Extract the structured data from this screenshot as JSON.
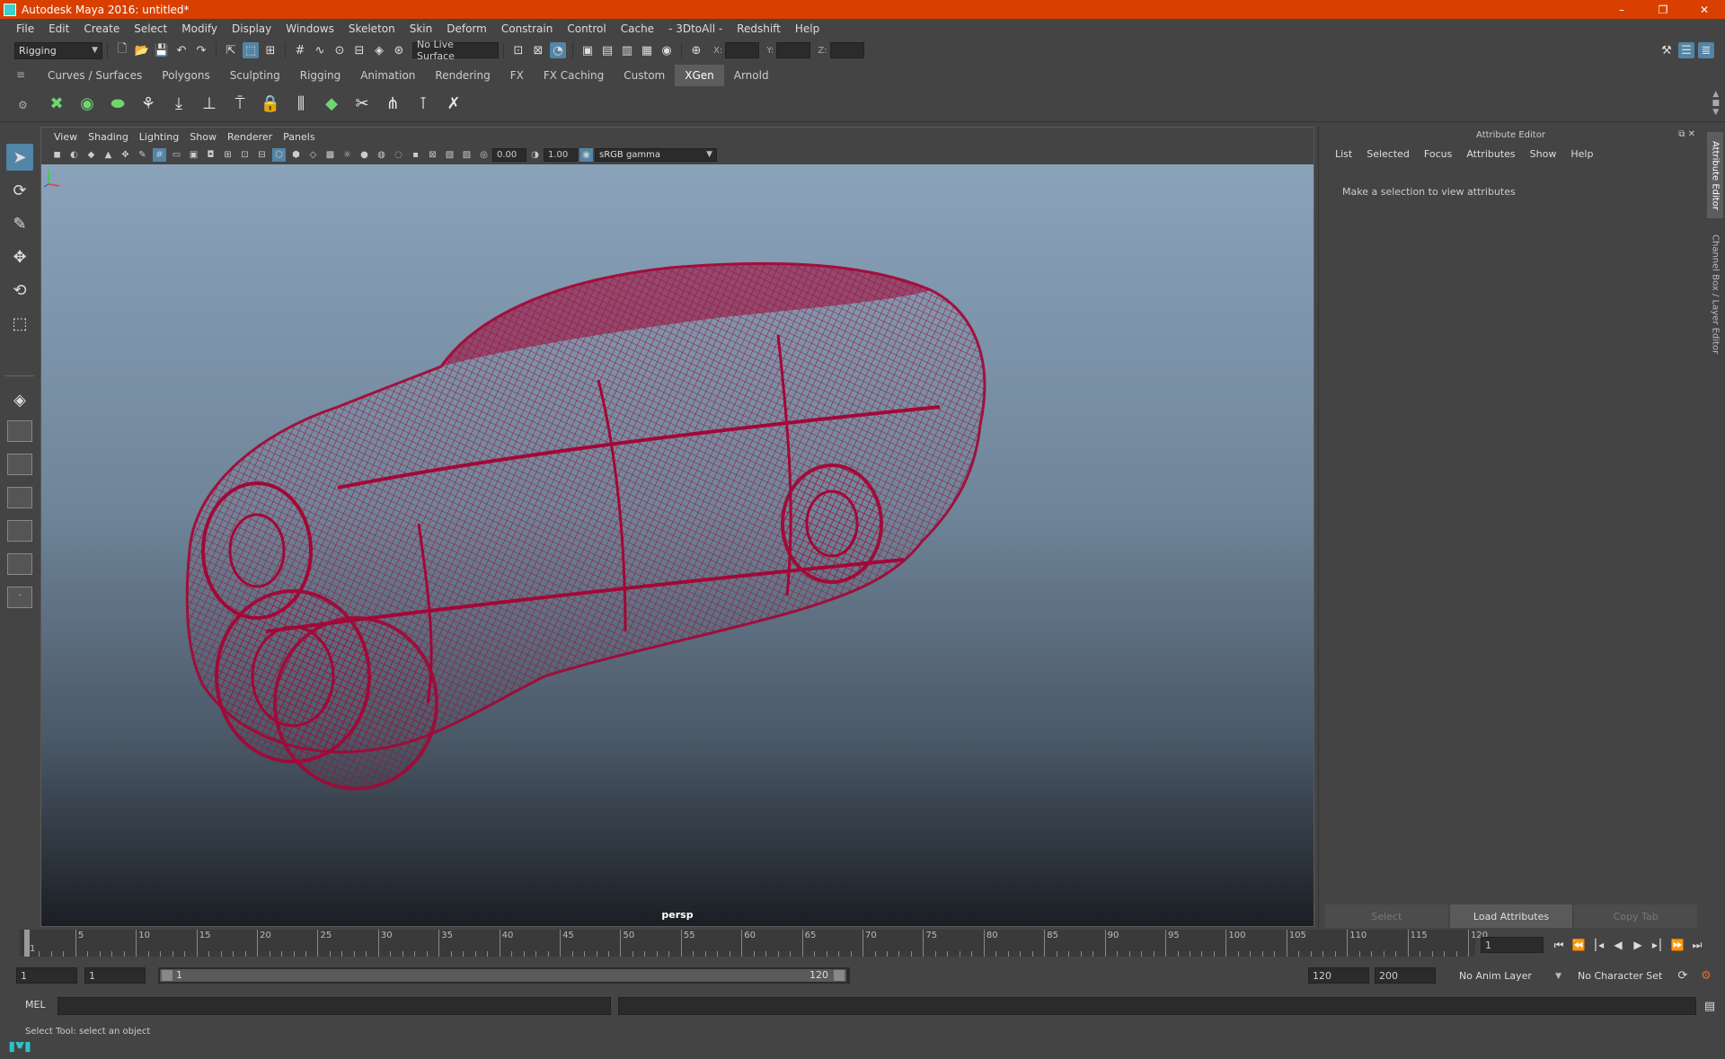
{
  "window": {
    "title": "Autodesk Maya 2016: untitled*",
    "controls": [
      "–",
      "❐",
      "✕"
    ]
  },
  "menubar": [
    "File",
    "Edit",
    "Create",
    "Select",
    "Modify",
    "Display",
    "Windows",
    "Skeleton",
    "Skin",
    "Deform",
    "Constrain",
    "Control",
    "Cache",
    "- 3DtoAll -",
    "Redshift",
    "Help"
  ],
  "statusline": {
    "menu_set": "Rigging",
    "live_surface": "No Live Surface",
    "coord_x_label": "X:",
    "coord_y_label": "Y:",
    "coord_z_label": "Z:"
  },
  "shelf": {
    "tabs": [
      "Curves / Surfaces",
      "Polygons",
      "Sculpting",
      "Rigging",
      "Animation",
      "Rendering",
      "FX",
      "FX Caching",
      "Custom",
      "XGen",
      "Arnold"
    ],
    "active_tab": "XGen"
  },
  "viewport": {
    "menu": [
      "View",
      "Shading",
      "Lighting",
      "Show",
      "Renderer",
      "Panels"
    ],
    "exposure": "0.00",
    "gamma": "1.00",
    "color_space": "sRGB gamma",
    "camera": "persp",
    "wire_color": "#a30836"
  },
  "attribute_editor": {
    "title": "Attribute Editor",
    "menu": [
      "List",
      "Selected",
      "Focus",
      "Attributes",
      "Show",
      "Help"
    ],
    "message": "Make a selection to view attributes",
    "buttons": {
      "select": "Select",
      "load": "Load Attributes",
      "copy": "Copy Tab"
    }
  },
  "side_tabs": {
    "attribute_editor": "Attribute Editor",
    "channel_box": "Channel Box / Layer Editor"
  },
  "timeslider": {
    "ticks": [
      1,
      5,
      10,
      15,
      20,
      25,
      30,
      35,
      40,
      45,
      50,
      55,
      60,
      65,
      70,
      75,
      80,
      85,
      90,
      95,
      100,
      105,
      110,
      115,
      120
    ],
    "current_frame": "1"
  },
  "range": {
    "start_time": "1",
    "playback_start": "1",
    "range_start": "1",
    "range_end": "120",
    "playback_end": "120",
    "end_time": "200",
    "anim_layer": "No Anim Layer",
    "character_set": "No Character Set"
  },
  "cmdline": {
    "label": "MEL"
  },
  "helpline": {
    "text": "Select Tool: select an object"
  },
  "colors": {
    "titlebar": "#d94000",
    "accent": "#5285a6",
    "background": "#444444"
  }
}
